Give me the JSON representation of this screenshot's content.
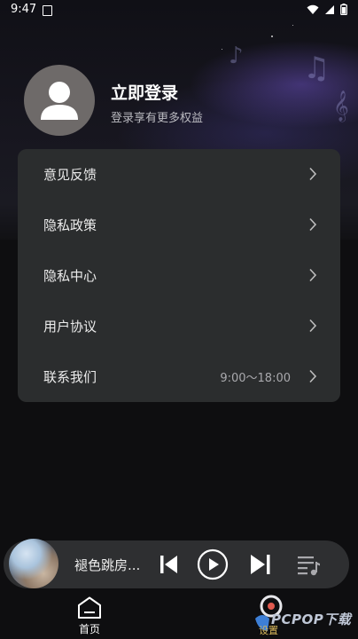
{
  "status_bar": {
    "time": "9:47"
  },
  "profile": {
    "title": "立即登录",
    "subtitle": "登录享有更多权益"
  },
  "menu": {
    "items": [
      {
        "label": "意见反馈",
        "value": ""
      },
      {
        "label": "隐私政策",
        "value": ""
      },
      {
        "label": "隐私中心",
        "value": ""
      },
      {
        "label": "用户协议",
        "value": ""
      },
      {
        "label": "联系我们",
        "value": "9:00～18:00"
      }
    ]
  },
  "player": {
    "song_title": "褪色跳房..."
  },
  "bottom_nav": {
    "home_label": "首页",
    "settings_label": "设置"
  },
  "watermark": {
    "text": "PCPOP下载"
  },
  "colors": {
    "card_bg": "#2b2d2e",
    "player_bg": "#2e2f31",
    "page_bg": "#0e0e10"
  }
}
